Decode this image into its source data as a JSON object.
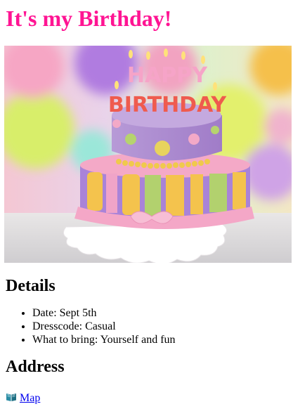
{
  "page": {
    "title": "It's my Birthday!",
    "title_color": "#ff1493",
    "link_color": "#0000ee"
  },
  "hero_image": {
    "icon": "birthday-cake-image",
    "candle_text_top": "HAPPY",
    "candle_text_bottom": "BIRTHDAY"
  },
  "details": {
    "heading": "Details",
    "items": [
      "Date: Sept 5th",
      "Dresscode: Casual",
      "What to bring: Yourself and fun"
    ]
  },
  "address": {
    "heading": "Address",
    "map_label": "Map",
    "map_icon": "book-icon"
  }
}
